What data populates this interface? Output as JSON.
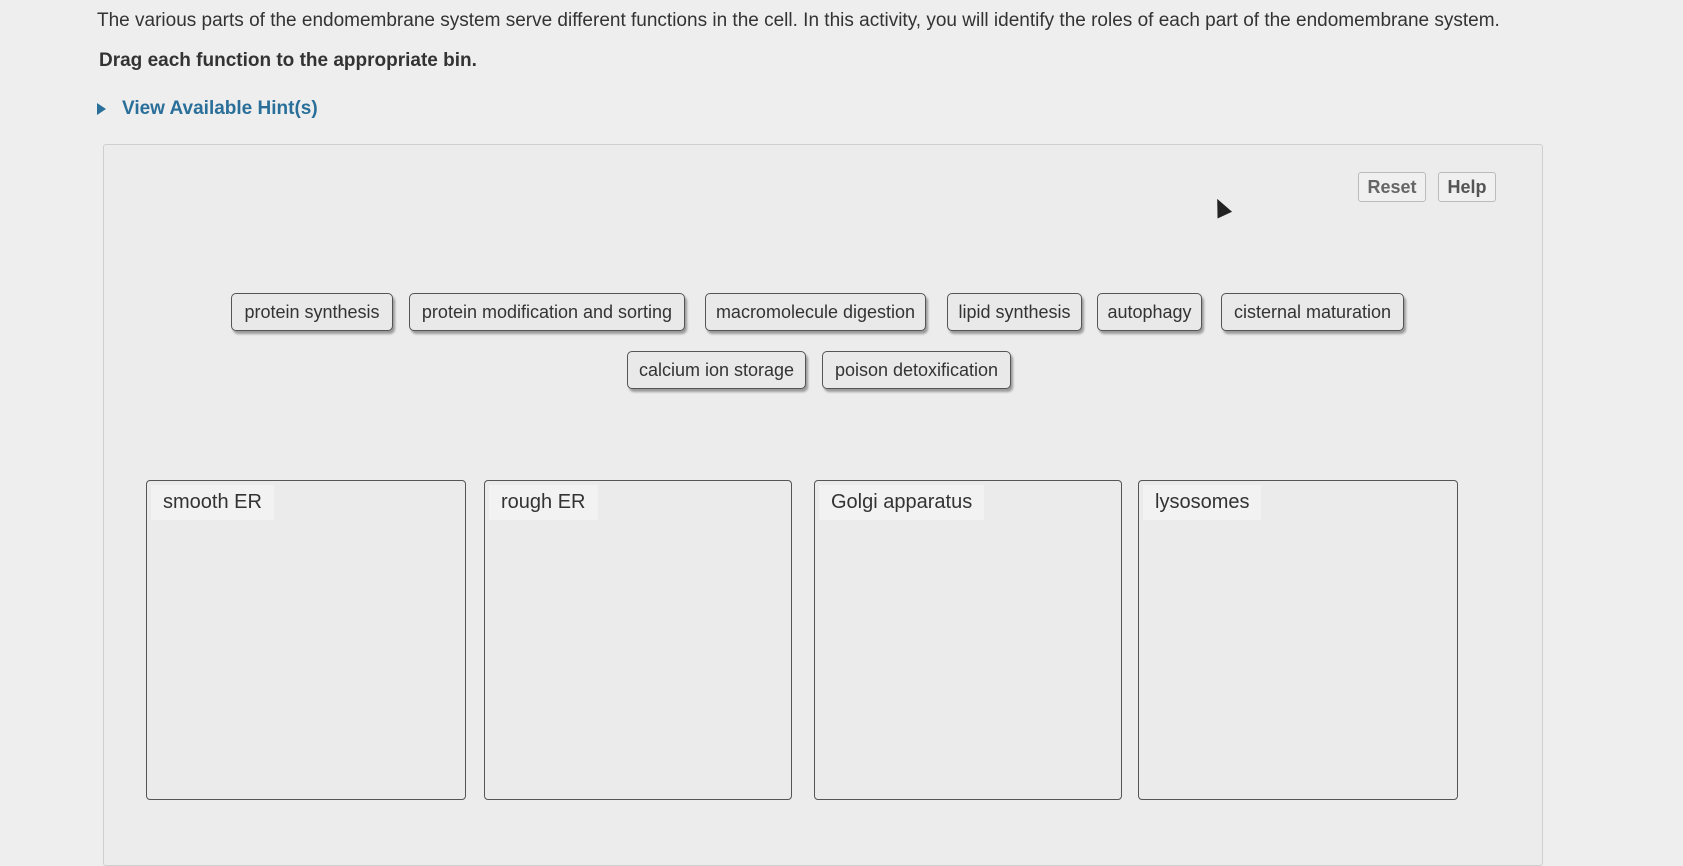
{
  "intro_text": "The various parts of the endomembrane system serve different functions in the cell. In this activity, you will identify the roles of each part of the endomembrane system.",
  "instruction": "Drag each function to the appropriate bin.",
  "hint_link": "View Available Hint(s)",
  "controls": {
    "reset": "Reset",
    "help": "Help"
  },
  "tokens": [
    "protein synthesis",
    "protein modification and sorting",
    "macromolecule digestion",
    "lipid synthesis",
    "autophagy",
    "cisternal maturation",
    "calcium ion storage",
    "poison detoxification"
  ],
  "bins": [
    {
      "label": "smooth ER"
    },
    {
      "label": "rough ER"
    },
    {
      "label": "Golgi apparatus"
    },
    {
      "label": "lysosomes"
    }
  ]
}
